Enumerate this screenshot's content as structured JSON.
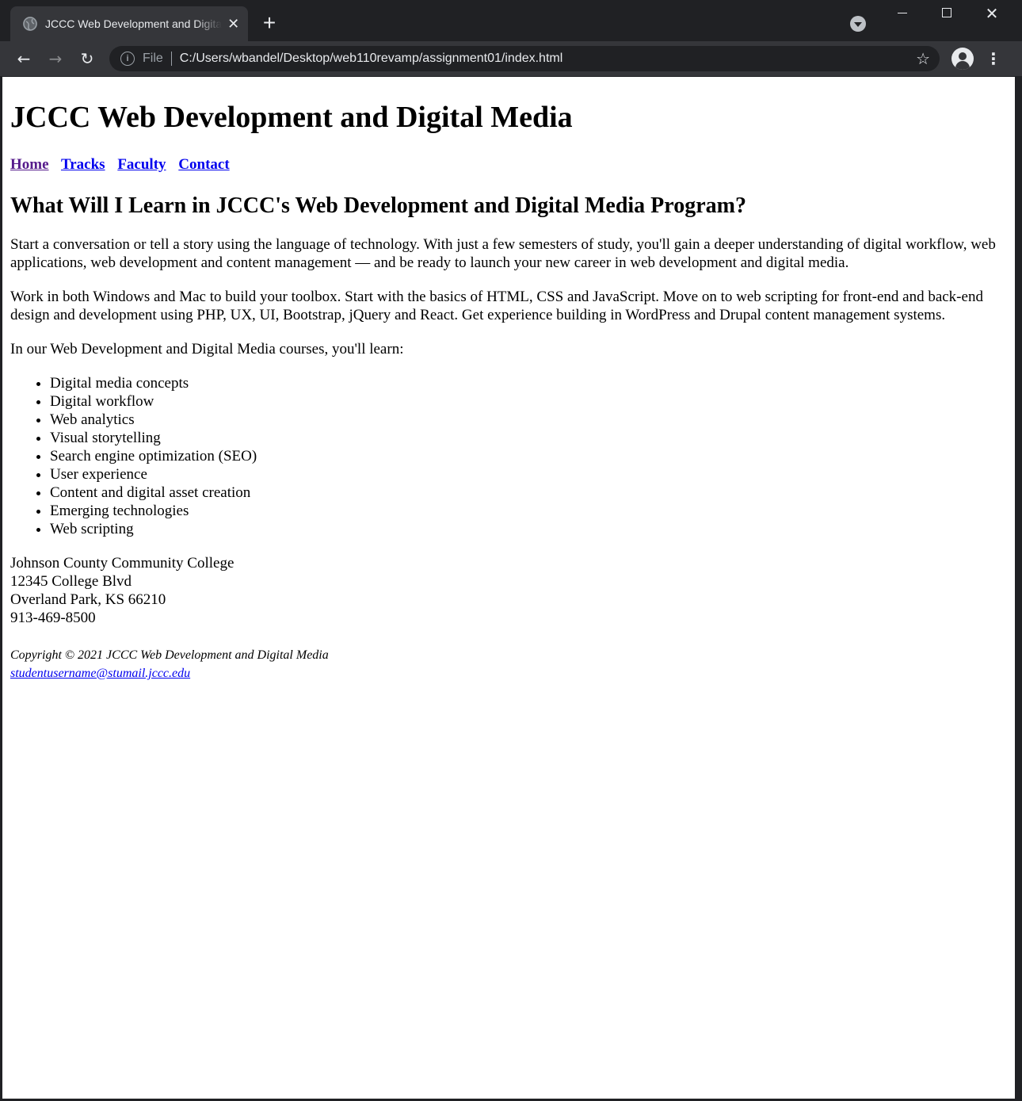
{
  "browser": {
    "tab_title": "JCCC Web Development and Digital Media",
    "tab_close": "✕",
    "new_tab": "+",
    "back": "←",
    "forward": "→",
    "reload": "↻",
    "omnibox": {
      "info": "i",
      "scheme": "File",
      "url": "C:/Users/wbandel/Desktop/web110revamp/assignment01/index.html",
      "star": "☆"
    },
    "menu": "⋮",
    "icons": [
      "globe-icon",
      "close-icon",
      "plus-icon",
      "tab-search-icon",
      "minimize-icon",
      "maximize-icon",
      "window-close-icon",
      "back-arrow-icon",
      "forward-arrow-icon",
      "reload-icon",
      "info-icon",
      "star-icon",
      "profile-icon",
      "kebab-menu-icon"
    ],
    "colors": {
      "frame": "#202124",
      "toolbar": "#35363a",
      "text": "#e8eaed",
      "muted": "#9aa0a6"
    }
  },
  "page": {
    "heading": "JCCC Web Development and Digital Media",
    "nav": {
      "home": "Home",
      "tracks": "Tracks",
      "faculty": "Faculty",
      "contact": "Contact"
    },
    "subheading": "What Will I Learn in JCCC's Web Development and Digital Media Program?",
    "paragraphs": [
      "Start a conversation or tell a story using the language of technology. With just a few semesters of study, you'll gain a deeper understanding of digital workflow, web applications, web development and content management — and be ready to launch your new career in web development and digital media.",
      "Work in both Windows and Mac to build your toolbox. Start with the basics of HTML, CSS and JavaScript. Move on to web scripting for front-end and back-end design and development using PHP, UX, UI, Bootstrap, jQuery and React. Get experience building in WordPress and Drupal content management systems.",
      "In our Web Development and Digital Media courses, you'll learn:"
    ],
    "topics": [
      "Digital media concepts",
      "Digital workflow",
      "Web analytics",
      "Visual storytelling",
      "Search engine optimization (SEO)",
      "User experience",
      "Content and digital asset creation",
      "Emerging technologies",
      "Web scripting"
    ],
    "address": {
      "name": "Johnson County Community College",
      "street": "12345 College Blvd",
      "city": "Overland Park, KS 66210",
      "phone": "913-469-8500"
    },
    "footer": {
      "copyright": "Copyright © 2021 JCCC Web Development and Digital Media",
      "email": "studentusername@stumail.jccc.edu"
    },
    "colors": {
      "link": "#0000ee",
      "visited": "#551a8b",
      "background": "#ffffff"
    }
  }
}
